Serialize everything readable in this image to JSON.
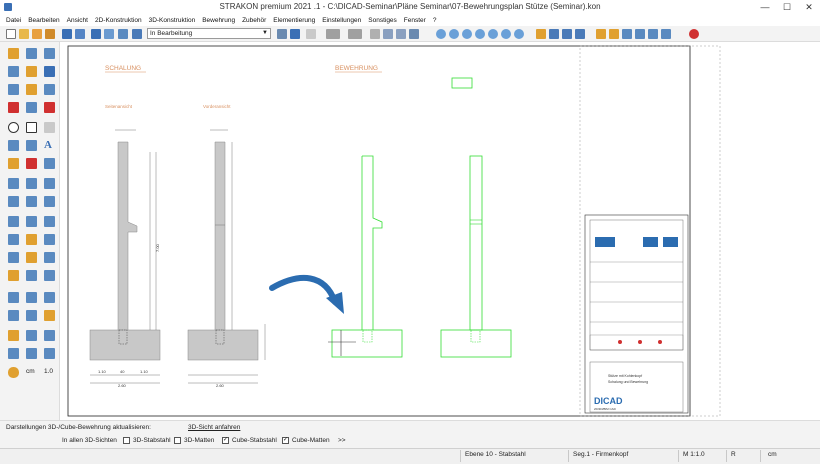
{
  "window": {
    "title": "STRAKON premium 2021 .1  -  C:\\DICAD-Seminar\\Pläne Seminar\\07-Bewehrungsplan Stütze (Seminar).kon",
    "minimize": "—",
    "maximize": "☐",
    "close": "✕"
  },
  "menu": [
    "Datei",
    "Bearbeiten",
    "Ansicht",
    "2D-Konstruktion",
    "3D-Konstruktion",
    "Bewehrung",
    "Zubehör",
    "Elementierung",
    "Einstellungen",
    "Sonstiges",
    "Fenster",
    "?"
  ],
  "toolbar": {
    "layer_select_value": "In Bearbeitung",
    "accent": "#2b6cb0"
  },
  "left_toolbar": {
    "cm_label": "cm",
    "cm_value": "1.0"
  },
  "drawing": {
    "heading_schalung": "SCHALUNG",
    "heading_bewehrung": "BEWEHRUNG",
    "label_seitenansicht": "Seitenansicht",
    "label_vorderansicht": "Vorderansicht",
    "dim_bottom_1": "1.10",
    "dim_bottom_2": "40",
    "dim_bottom_3": "1.10",
    "dim_total": "2.60",
    "dim_height": "7.00",
    "rebar_color": "#33dd33",
    "concrete_color": "#c8c8c8",
    "heading_color": "#d89060",
    "arrow_color": "#2b6cb0"
  },
  "title_block": {
    "company": "DICAD",
    "company_sub": "2D/3D/BIM CAD",
    "project": "Stütze mit Kohlenkopf",
    "plan": "Schalung und Bewehrung"
  },
  "status_rows": {
    "row1_left": "Darstellungen 3D-/Cube-Bewehrung aktualisieren:",
    "row1_right": "3D-Sicht anfahren",
    "row2_label": "In allen 3D-Sichten",
    "checks": [
      {
        "label": "3D-Stabstahl",
        "checked": false
      },
      {
        "label": "3D-Matten",
        "checked": false
      },
      {
        "label": "Cube-Stabstahl",
        "checked": true
      },
      {
        "label": "Cube-Matten",
        "checked": true
      }
    ],
    "more": ">>"
  },
  "statusbar": {
    "layer": "Ebene 10   - Stabstahl",
    "segment": "Seg.1    - Firmenkopf",
    "scale": "M 1:1.0",
    "r": "R",
    "unit": "cm"
  }
}
